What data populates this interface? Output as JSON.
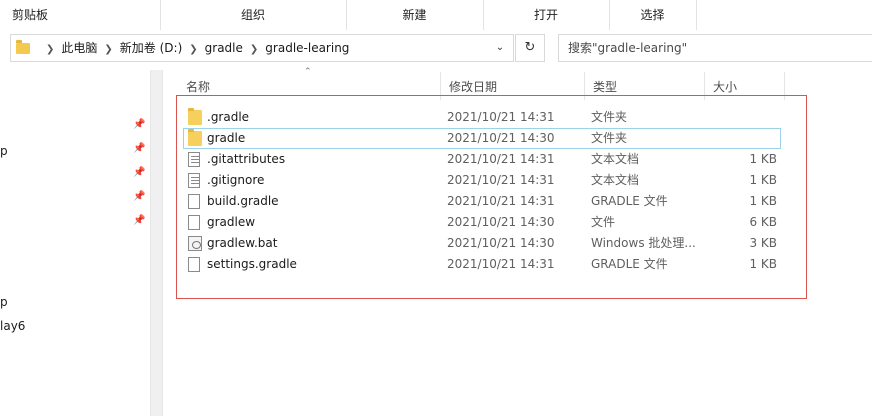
{
  "ribbon": {
    "groups": [
      "剪贴板",
      "组织",
      "新建",
      "打开",
      "选择"
    ]
  },
  "address": {
    "crumbs": [
      "此电脑",
      "新加卷 (D:)",
      "gradle",
      "gradle-learing"
    ],
    "dropdown_icon": "chevron-down-icon",
    "refresh_icon": "refresh-icon"
  },
  "search": {
    "placeholder": "搜索\"gradle-learing\""
  },
  "nav": {
    "items": [
      "p",
      "p",
      "lay6"
    ]
  },
  "columns": {
    "name": "名称",
    "date": "修改日期",
    "type": "类型",
    "size": "大小"
  },
  "files": [
    {
      "name": ".gradle",
      "date": "2021/10/21 14:31",
      "type": "文件夹",
      "size": "",
      "icon": "folder-icon"
    },
    {
      "name": "gradle",
      "date": "2021/10/21 14:30",
      "type": "文件夹",
      "size": "",
      "icon": "folder-icon"
    },
    {
      "name": ".gitattributes",
      "date": "2021/10/21 14:31",
      "type": "文本文档",
      "size": "1 KB",
      "icon": "text-document-icon"
    },
    {
      "name": ".gitignore",
      "date": "2021/10/21 14:31",
      "type": "文本文档",
      "size": "1 KB",
      "icon": "text-document-icon"
    },
    {
      "name": "build.gradle",
      "date": "2021/10/21 14:31",
      "type": "GRADLE 文件",
      "size": "1 KB",
      "icon": "file-icon"
    },
    {
      "name": "gradlew",
      "date": "2021/10/21 14:30",
      "type": "文件",
      "size": "6 KB",
      "icon": "file-icon"
    },
    {
      "name": "gradlew.bat",
      "date": "2021/10/21 14:30",
      "type": "Windows 批处理...",
      "size": "3 KB",
      "icon": "batch-file-icon"
    },
    {
      "name": "settings.gradle",
      "date": "2021/10/21 14:31",
      "type": "GRADLE 文件",
      "size": "1 KB",
      "icon": "file-icon"
    }
  ],
  "colors": {
    "highlight_border": "#d9534f",
    "selection_border": "#9dd3e8",
    "folder": "#f6cf5c"
  }
}
